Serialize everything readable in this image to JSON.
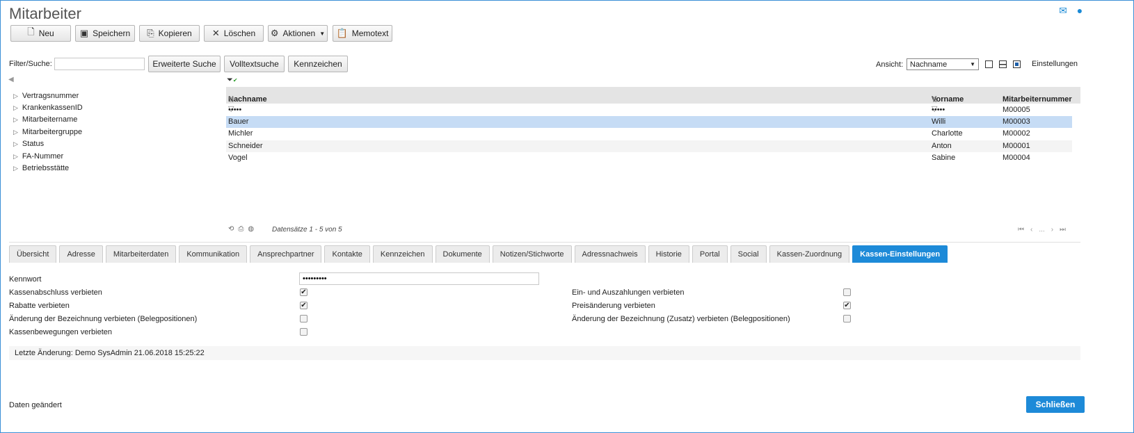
{
  "window": {
    "title": "Mitarbeiter"
  },
  "toolbar": {
    "new": "Neu",
    "save": "Speichern",
    "copy": "Kopieren",
    "delete": "Löschen",
    "actions": "Aktionen",
    "memo": "Memotext"
  },
  "filter": {
    "label": "Filter/Suche:",
    "value": "",
    "extended": "Erweiterte Suche",
    "fulltext": "Volltextsuche",
    "flags": "Kennzeichen"
  },
  "view": {
    "label": "Ansicht:",
    "selected": "Nachname",
    "settings": "Einstellungen"
  },
  "tree": [
    "Vertragsnummer",
    "KrankenkassenID",
    "Mitarbeitername",
    "Mitarbeitergruppe",
    "Status",
    "FA-Nummer",
    "Betriebsstätte"
  ],
  "grid": {
    "columns": [
      "Nachname",
      "Vorname",
      "Mitarbeiternummer"
    ],
    "rows": [
      {
        "nachname": "•••••",
        "vorname": "•••••",
        "nummer": "M00005"
      },
      {
        "nachname": "Bauer",
        "vorname": "Willi",
        "nummer": "M00003"
      },
      {
        "nachname": "Michler",
        "vorname": "Charlotte",
        "nummer": "M00002"
      },
      {
        "nachname": "Schneider",
        "vorname": "Anton",
        "nummer": "M00001"
      },
      {
        "nachname": "Vogel",
        "vorname": "Sabine",
        "nummer": "M00004"
      }
    ],
    "selected_row": 1,
    "records": "Datensätze 1 - 5 von 5",
    "pager_ellipsis": "..."
  },
  "tabs": [
    "Übersicht",
    "Adresse",
    "Mitarbeiterdaten",
    "Kommunikation",
    "Ansprechpartner",
    "Kontakte",
    "Kennzeichen",
    "Dokumente",
    "Notizen/Stichworte",
    "Adressnachweis",
    "Historie",
    "Portal",
    "Social",
    "Kassen-Zuordnung",
    "Kassen-Einstellungen"
  ],
  "active_tab": "Kassen-Einstellungen",
  "form": {
    "password_label": "Kennwort",
    "password_value": "•••••••••",
    "left": [
      {
        "label": "Kassenabschluss verbieten",
        "checked": true
      },
      {
        "label": "Rabatte verbieten",
        "checked": true
      },
      {
        "label": "Änderung der Bezeichnung verbieten (Belegpositionen)",
        "checked": false
      },
      {
        "label": "Kassenbewegungen verbieten",
        "checked": false
      }
    ],
    "right": [
      {
        "label": "Ein- und Auszahlungen verbieten",
        "checked": false
      },
      {
        "label": "Preisänderung verbieten",
        "checked": true
      },
      {
        "label": "Änderung der Bezeichnung (Zusatz) verbieten (Belegpositionen)",
        "checked": false
      }
    ]
  },
  "last_change": "Letzte Änderung: Demo SysAdmin 21.06.2018 15:25:22",
  "status": "Daten geändert",
  "close": "Schließen",
  "colors": {
    "accent": "#1d8ad8",
    "selected_row": "#c6dcf5"
  }
}
